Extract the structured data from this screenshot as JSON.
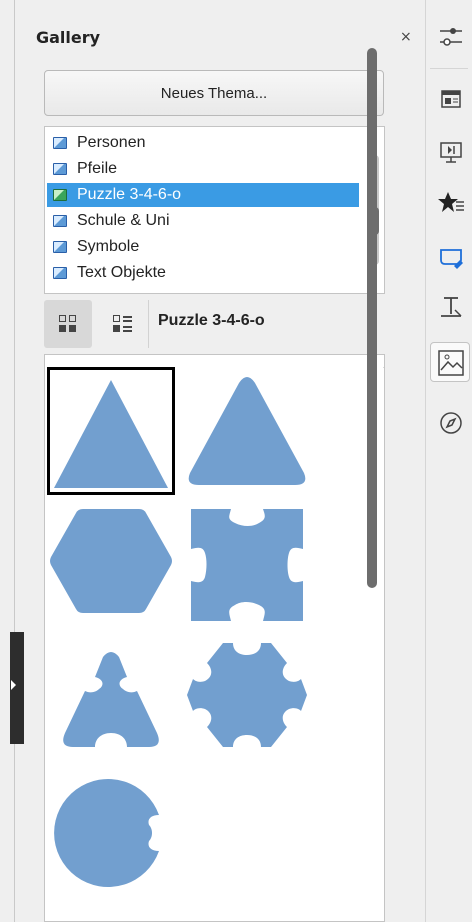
{
  "panel": {
    "title": "Gallery",
    "close_symbol": "×",
    "new_theme_button": "Neues Thema..."
  },
  "theme_list": {
    "items": [
      {
        "label": "Personen",
        "selected": false
      },
      {
        "label": "Pfeile",
        "selected": false
      },
      {
        "label": "Puzzle 3-4-6-o",
        "selected": true
      },
      {
        "label": "Schule & Uni",
        "selected": false
      },
      {
        "label": "Symbole",
        "selected": false
      },
      {
        "label": "Text Objekte",
        "selected": false
      }
    ],
    "scroll_up_symbol": "⌃",
    "scroll_down_symbol": "⌄"
  },
  "view": {
    "current_theme_label": "Puzzle 3-4-6-o",
    "icon_view_icon": "icon-view-icon",
    "list_view_icon": "detail-view-icon"
  },
  "gallery": {
    "items": [
      {
        "name": "triangle-sharp",
        "selected": true
      },
      {
        "name": "triangle-rounded",
        "selected": false
      },
      {
        "name": "hexagon",
        "selected": false
      },
      {
        "name": "puzzle-square",
        "selected": false
      },
      {
        "name": "puzzle-triangle",
        "selected": false
      },
      {
        "name": "puzzle-hexagon",
        "selected": false
      },
      {
        "name": "puzzle-circle",
        "selected": false
      }
    ],
    "shape_color": "#729fcf",
    "scroll_up_symbol": "⌃"
  },
  "tabbar": {
    "tabs": [
      {
        "name": "properties-icon",
        "active": false
      },
      {
        "name": "styles-icon",
        "active": false
      },
      {
        "name": "slide-transition-icon",
        "active": false
      },
      {
        "name": "animation-icon",
        "active": false
      },
      {
        "name": "master-slides-icon",
        "active": false
      },
      {
        "name": "shapes-icon",
        "active": false
      },
      {
        "name": "gallery-icon",
        "active": true
      },
      {
        "name": "navigator-icon",
        "active": false
      }
    ]
  },
  "colors": {
    "selection": "#3a9be4",
    "accent_blue": "#1e6fd9"
  }
}
